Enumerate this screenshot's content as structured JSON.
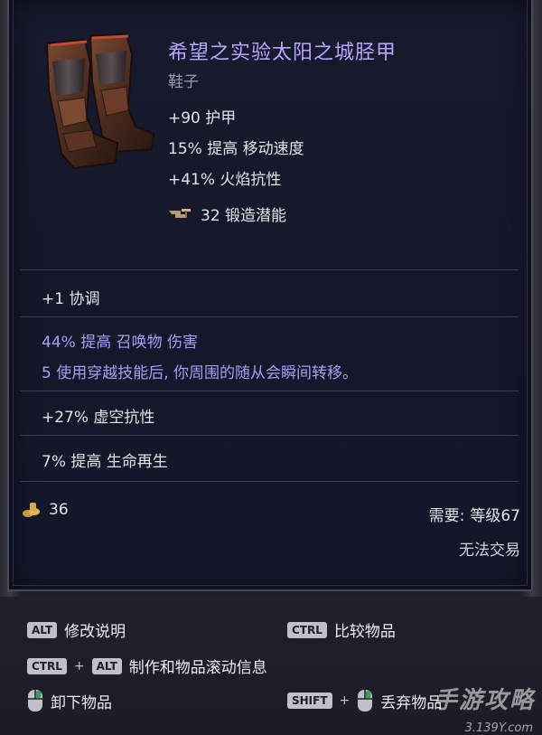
{
  "item": {
    "name": "希望之实验太阳之城胫甲",
    "type": "鞋子",
    "stats": [
      "+90 护甲",
      "15% 提高 移动速度",
      "+41% 火焰抗性"
    ],
    "forge_potential": "32 锻造潜能",
    "forge_icon": "anvil-hammer-icon"
  },
  "affixes": [
    {
      "text": "+1 协调",
      "color": "#e3e3ea"
    },
    {
      "text": "44% 提高 召唤物 伤害",
      "color": "#a99cf2"
    },
    {
      "text": "5 使用穿越技能后, 你周围的随从会瞬间转移。",
      "color": "#a99cf2"
    },
    {
      "text": "+27% 虚空抗性",
      "color": "#e3e3ea"
    },
    {
      "text": "7% 提高 生命再生",
      "color": "#e3e3ea"
    }
  ],
  "footer_info": {
    "gold_value": "36",
    "requirement_label": "需要:",
    "requirement_value": "等级67",
    "trade_status": "无法交易"
  },
  "hints": {
    "alt_key": "ALT",
    "alt_label": "修改说明",
    "ctrl_key": "CTRL",
    "ctrl_label": "比较物品",
    "combo_key1": "CTRL",
    "combo_key2": "ALT",
    "combo_label": "制作和物品滚动信息",
    "unequip_label": "卸下物品",
    "shift_key": "SHIFT",
    "drop_label": "丢弃物品"
  },
  "watermark": {
    "text": "手游攻略",
    "sub": "3.139Y.com"
  },
  "colors": {
    "name": "#b9a6ff",
    "magic_affix": "#a99cf2",
    "panel_bg": "#161a2c"
  }
}
